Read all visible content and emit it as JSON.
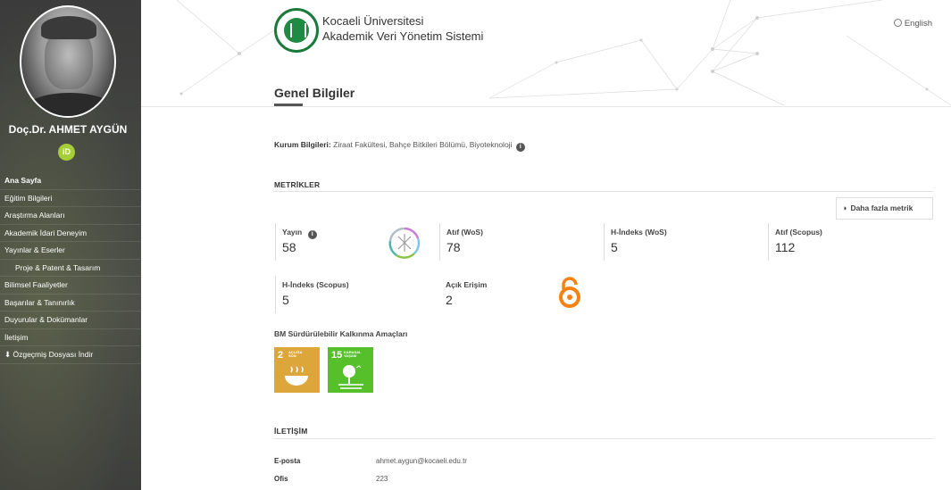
{
  "profile": {
    "name": "Doç.Dr. AHMET AYGÜN",
    "orcid_label": "iD"
  },
  "nav": [
    {
      "label": "Ana Sayfa",
      "active": true
    },
    {
      "label": "Eğitim Bilgileri"
    },
    {
      "label": "Araştırma Alanları"
    },
    {
      "label": "Akademik İdari Deneyim"
    },
    {
      "label": "Yayınlar & Eserler"
    },
    {
      "label": "Proje & Patent & Tasarım",
      "sub": true
    },
    {
      "label": "Bilimsel Faaliyetler"
    },
    {
      "label": "Başarılar & Tanınırlık"
    },
    {
      "label": "Duyurular & Dokümanlar"
    },
    {
      "label": "İletişim"
    },
    {
      "label": "⬇ Özgeçmiş Dosyası İndir"
    }
  ],
  "header": {
    "university": "Kocaeli Üniversitesi",
    "system": "Akademik Veri Yönetim Sistemi",
    "language": "English",
    "page_title": "Genel Bilgiler"
  },
  "kurum": {
    "label": "Kurum Bilgileri:",
    "value": "Ziraat Fakültesi, Bahçe Bitkileri Bölümü, Biyoteknoloji"
  },
  "metrics": {
    "section_title": "METRİKLER",
    "more_button": "Daha fazla metrik",
    "items": [
      {
        "label": "Yayın",
        "value": "58"
      },
      {
        "label": "Atıf (WoS)",
        "value": "78"
      },
      {
        "label": "H-İndeks (WoS)",
        "value": "5"
      },
      {
        "label": "Atıf (Scopus)",
        "value": "112"
      },
      {
        "label": "H-İndeks (Scopus)",
        "value": "5"
      },
      {
        "label": "Açık Erişim",
        "value": "2"
      }
    ]
  },
  "sdg": {
    "title": "BM Sürdürülebilir Kalkınma Amaçları",
    "goals": [
      {
        "number": "2",
        "text": "AÇLIĞA SON",
        "color": "#dda63a"
      },
      {
        "number": "15",
        "text": "KARASAL YAŞAM",
        "color": "#56c02b"
      }
    ]
  },
  "contact": {
    "section_title": "İLETİŞİM",
    "rows": [
      {
        "key": "E-posta",
        "value": "ahmet.aygun@kocaeli.edu.tr"
      },
      {
        "key": "Ofis",
        "value": "223"
      }
    ]
  },
  "colors": {
    "sidebar": "#454641",
    "accent_green": "#1f8a44",
    "open_access": "#f68212"
  }
}
